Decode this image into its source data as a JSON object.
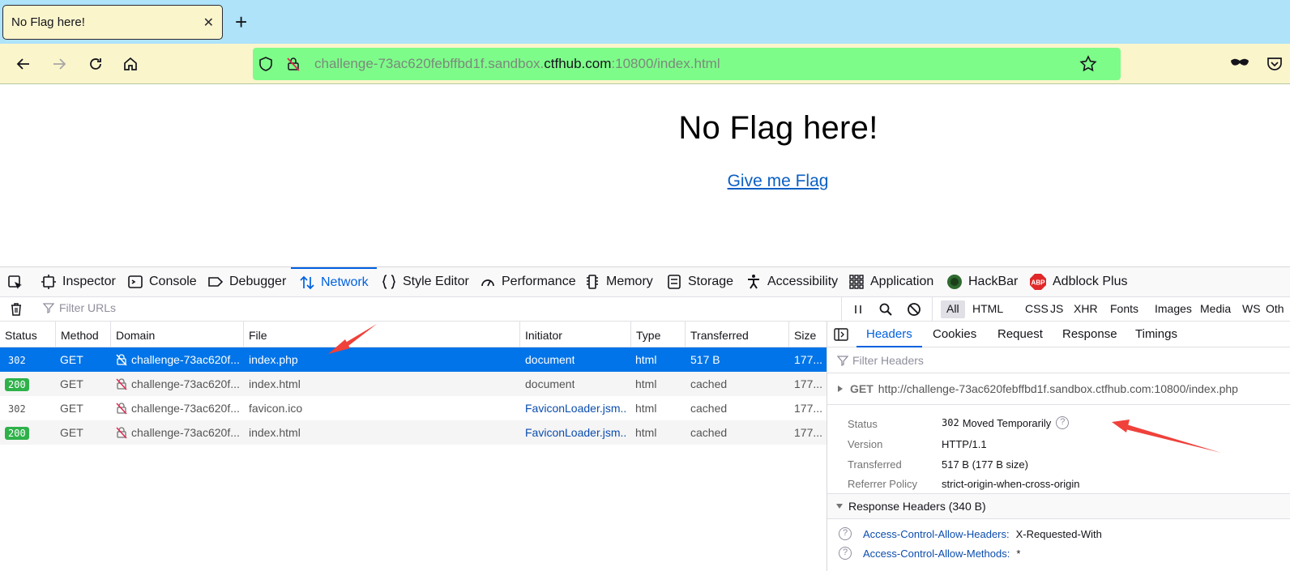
{
  "tab": {
    "title": "No Flag here!",
    "close": "✕",
    "new_tab": "+"
  },
  "nav": {
    "url_prefix": "challenge-73ac620febffbd1f.sandbox.",
    "url_host": "ctfhub.com",
    "url_suffix": ":10800/index.html"
  },
  "page": {
    "heading": "No Flag here!",
    "link": "Give me Flag"
  },
  "devtools": {
    "tabs": [
      {
        "label": "Inspector",
        "icon": "inspector-icon"
      },
      {
        "label": "Console",
        "icon": "console-icon"
      },
      {
        "label": "Debugger",
        "icon": "debugger-icon"
      },
      {
        "label": "Network",
        "icon": "network-icon",
        "active": true
      },
      {
        "label": "Style Editor",
        "icon": "style-editor-icon"
      },
      {
        "label": "Performance",
        "icon": "performance-icon"
      },
      {
        "label": "Memory",
        "icon": "memory-icon"
      },
      {
        "label": "Storage",
        "icon": "storage-icon"
      },
      {
        "label": "Accessibility",
        "icon": "accessibility-icon"
      },
      {
        "label": "Application",
        "icon": "application-icon"
      },
      {
        "label": "HackBar",
        "icon": "hackbar-icon"
      },
      {
        "label": "Adblock Plus",
        "icon": "adblock-icon"
      }
    ],
    "filter_placeholder": "Filter URLs",
    "type_filters": [
      "All",
      "HTML",
      "CSS",
      "JS",
      "XHR",
      "Fonts",
      "Images",
      "Media",
      "WS",
      "Oth"
    ],
    "columns": [
      "Status",
      "Method",
      "Domain",
      "File",
      "Initiator",
      "Type",
      "Transferred",
      "Size"
    ],
    "requests": [
      {
        "status": "302",
        "method": "GET",
        "domain": "challenge-73ac620f...",
        "file": "index.php",
        "initiator": "document",
        "type": "html",
        "transferred": "517 B",
        "size": "177..."
      },
      {
        "status": "200",
        "method": "GET",
        "domain": "challenge-73ac620f...",
        "file": "index.html",
        "initiator": "document",
        "type": "html",
        "transferred": "cached",
        "size": "177..."
      },
      {
        "status": "302",
        "method": "GET",
        "domain": "challenge-73ac620f...",
        "file": "favicon.ico",
        "initiator": "FaviconLoader.jsm...",
        "type": "html",
        "transferred": "cached",
        "size": "177..."
      },
      {
        "status": "200",
        "method": "GET",
        "domain": "challenge-73ac620f...",
        "file": "index.html",
        "initiator": "FaviconLoader.jsm...",
        "type": "html",
        "transferred": "cached",
        "size": "177..."
      }
    ],
    "side_tabs": [
      "Headers",
      "Cookies",
      "Request",
      "Response",
      "Timings"
    ],
    "filter_headers_placeholder": "Filter Headers",
    "request_line": {
      "method": "GET",
      "url": "http://challenge-73ac620febffbd1f.sandbox.ctfhub.com:10800/index.php"
    },
    "summary": {
      "status_label": "Status",
      "status_code": "302",
      "status_text": "Moved Temporarily",
      "version_label": "Version",
      "version": "HTTP/1.1",
      "transferred_label": "Transferred",
      "transferred": "517 B (177 B size)",
      "referrer_label": "Referrer Policy",
      "referrer": "strict-origin-when-cross-origin"
    },
    "response_headers_title": "Response Headers (340 B)",
    "response_headers": [
      {
        "name": "Access-Control-Allow-Headers:",
        "value": "X-Requested-With"
      },
      {
        "name": "Access-Control-Allow-Methods:",
        "value": "*"
      }
    ]
  },
  "colors": {
    "tabstrip": "#aee3f9",
    "navbar": "#fbf5cc",
    "urlbar": "#7efc8a",
    "selected_row": "#0074e8",
    "accent": "#0061e0",
    "arrow": "#f0413a"
  }
}
